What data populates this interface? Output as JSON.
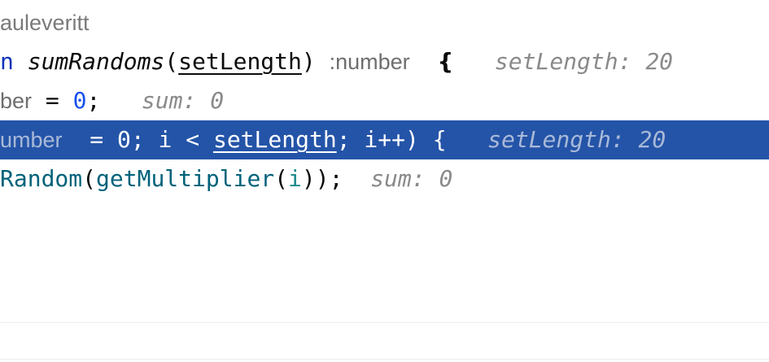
{
  "author": "auleveritt",
  "line1": {
    "keyword_tail": "n",
    "function_name": "sumRandoms",
    "open_paren": "(",
    "param": "setLength",
    "close_paren": ")",
    "return_type": ":number",
    "brace": "{",
    "hint": "setLength: 20"
  },
  "line2": {
    "prefix": "ber",
    "assign": " = ",
    "value": "0",
    "semi": ";",
    "hint": "sum: 0"
  },
  "line3": {
    "type_tail": "umber",
    "code_a": " = 0; i < ",
    "param": "setLength",
    "code_b": "; i++) {",
    "hint": "setLength: 20"
  },
  "line4": {
    "func_a": "Random",
    "paren_a": "(",
    "func_b": "getMultiplier",
    "paren_b": "(",
    "var": "i",
    "close": "));",
    "hint": "sum: 0"
  },
  "colors": {
    "selection": "#2454a8",
    "keyword": "#0b33b8",
    "number": "#1750eb",
    "function_call": "#00627a",
    "hint": "#8a8a8a"
  }
}
